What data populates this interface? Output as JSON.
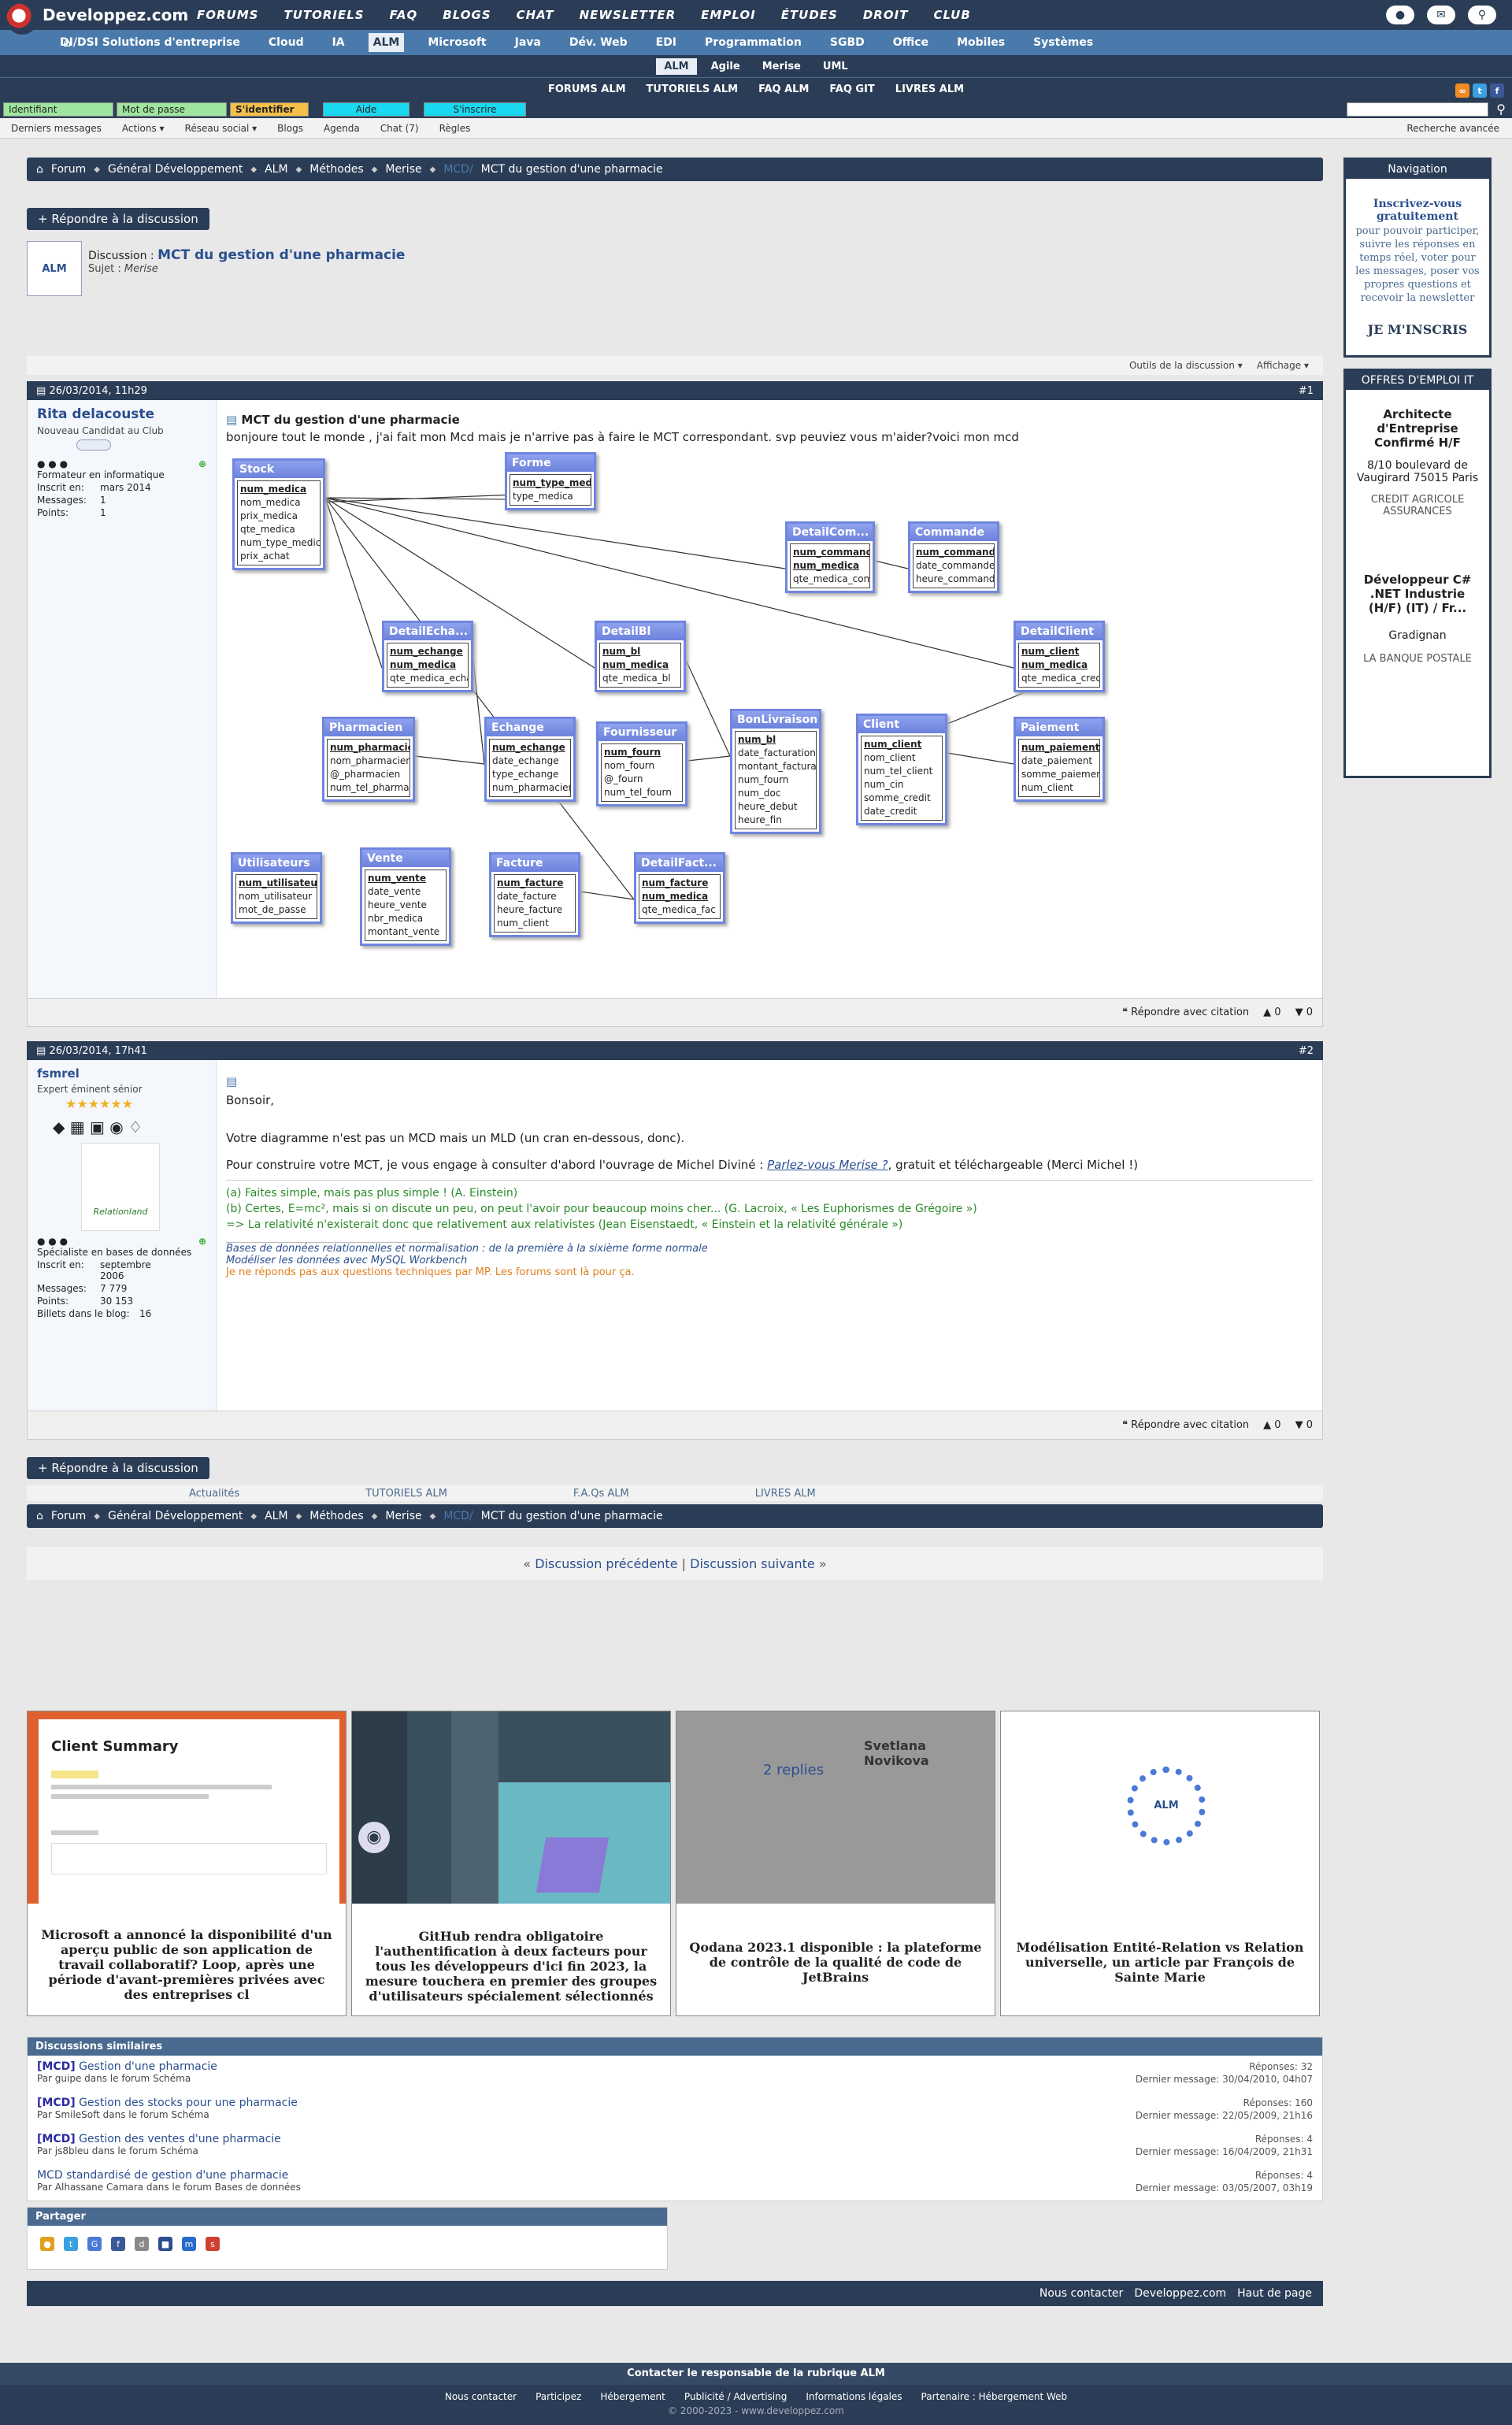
{
  "site": {
    "logo": "Developpez.com"
  },
  "topnav": [
    "FORUMS",
    "TUTORIELS",
    "FAQ",
    "BLOGS",
    "CHAT",
    "NEWSLETTER",
    "EMPLOI",
    "ÉTUDES",
    "DROIT",
    "CLUB"
  ],
  "catnav": [
    "DI/DSI Solutions d'entreprise",
    "Cloud",
    "IA",
    "ALM",
    "Microsoft",
    "Java",
    "Dév. Web",
    "EDI",
    "Programmation",
    "SGBD",
    "Office",
    "Mobiles",
    "Systèmes"
  ],
  "catnav_active": "ALM",
  "subnav": [
    "ALM",
    "Agile",
    "Merise",
    "UML"
  ],
  "subnav_active": "ALM",
  "almnav": [
    "FORUMS ALM",
    "TUTORIELS ALM",
    "FAQ ALM",
    "FAQ GIT",
    "LIVRES ALM"
  ],
  "login": {
    "id": "Identifiant",
    "pwd": "Mot de passe",
    "login": "S'identifier",
    "help": "Aide",
    "register": "S'inscrire"
  },
  "subbar": {
    "items": [
      "Derniers messages",
      "Actions ▾",
      "Réseau social ▾",
      "Blogs",
      "Agenda",
      "Chat (7)",
      "Règles"
    ],
    "right": "Recherche avancée"
  },
  "breadcrumb": [
    "Forum",
    "Général Développement",
    "ALM",
    "Méthodes",
    "Merise",
    "MCT du gestion d'une pharmacie"
  ],
  "breadcrumb_hl": "MCD/",
  "reply_label": "+ Répondre à la discussion",
  "thread": {
    "label": "Discussion :",
    "title": "MCT du gestion d'une pharmacie",
    "subject_label": "Sujet :",
    "subject": "Merise"
  },
  "tools": {
    "a": "Outils de la discussion ▾",
    "b": "Affichage ▾"
  },
  "posts": [
    {
      "date": "26/03/2014, 11h29",
      "num": "#1",
      "user": "Rita delacouste",
      "rank": "Nouveau Candidat au Club",
      "job": "Formateur en informatique",
      "joined_label": "Inscrit en:",
      "joined": "mars 2014",
      "msgs_label": "Messages:",
      "msgs": "1",
      "pts_label": "Points:",
      "pts": "1",
      "title": "MCT du gestion d'une pharmacie",
      "text": "bonjoure tout le monde , j'ai fait mon Mcd mais je n'arrive pas à faire le MCT correspondant. svp peuviez vous m'aider?voici mon mcd"
    },
    {
      "date": "26/03/2014, 17h41",
      "num": "#2",
      "user": "fsmrel",
      "rank": "Expert éminent sénior",
      "job": "Spécialiste en bases de données",
      "joined_label": "Inscrit en:",
      "joined": "septembre 2006",
      "msgs_label": "Messages:",
      "msgs": "7 779",
      "pts_label": "Points:",
      "pts": "30 153",
      "blog_label": "Billets dans le blog:",
      "blog": "16",
      "avatar_caption": "Relationland",
      "greet": "Bonsoir,",
      "p1": "Votre diagramme n'est pas un MCD mais un MLD (un cran en-dessous, donc).",
      "p2a": "Pour construire votre MCT, je vous engage à consulter d'abord l'ouvrage de Michel Diviné :",
      "p2link": "Parlez-vous Merise ?",
      "p2b": ", gratuit et téléchargeable (Merci Michel !)",
      "sig1": "(a) Faites simple, mais pas plus simple ! (A. Einstein)",
      "sig2": "(b) Certes, E=mc², mais si on discute un peu, on peut l'avoir pour beaucoup moins cher... (G. Lacroix, « Les Euphorismes de Grégoire »)",
      "sig3": "=> La relativité n'existerait donc que relativement aux relativistes (Jean Eisenstaedt, « Einstein et la relativité générale »)",
      "ref1": "Bases de données relationnelles et normalisation : de la première à la sixième forme normale",
      "ref2": "Modéliser les données avec MySQL Workbench",
      "ref3": "Je ne réponds pas aux questions techniques par MP. Les forums sont là pour ça."
    }
  ],
  "postfoot": {
    "quote": "Répondre avec citation",
    "up": "0",
    "down": "0"
  },
  "diagram": [
    {
      "name": "Stock",
      "cols": [
        "num_medica",
        "nom_medica",
        "prix_medica",
        "qte_medica",
        "num_type_medic",
        "prix_achat"
      ],
      "keys": 1
    },
    {
      "name": "Forme",
      "cols": [
        "num_type_medic",
        "type_medica"
      ],
      "keys": 1
    },
    {
      "name": "DetailCom...",
      "cols": [
        "num_commande",
        "num_medica",
        "qte_medica_com"
      ],
      "keys": 2
    },
    {
      "name": "Commande",
      "cols": [
        "num_commande",
        "date_commande",
        "heure_commande"
      ],
      "keys": 1
    },
    {
      "name": "DetailEcha...",
      "cols": [
        "num_echange",
        "num_medica",
        "qte_medica_echa"
      ],
      "keys": 2
    },
    {
      "name": "DetailBl",
      "cols": [
        "num_bl",
        "num_medica",
        "qte_medica_bl"
      ],
      "keys": 2
    },
    {
      "name": "DetailClient",
      "cols": [
        "num_client",
        "num_medica",
        "qte_medica_cred"
      ],
      "keys": 2
    },
    {
      "name": "Pharmacien",
      "cols": [
        "num_pharmacien",
        "nom_pharmacien",
        "@_pharmacien",
        "num_tel_pharma"
      ],
      "keys": 1
    },
    {
      "name": "Echange",
      "cols": [
        "num_echange",
        "date_echange",
        "type_echange",
        "num_pharmacien"
      ],
      "keys": 1
    },
    {
      "name": "Fournisseur",
      "cols": [
        "num_fourn",
        "nom_fourn",
        "@_fourn",
        "num_tel_fourn"
      ],
      "keys": 1
    },
    {
      "name": "BonLivraison",
      "cols": [
        "num_bl",
        "date_facturation",
        "montant_factura",
        "num_fourn",
        "num_doc",
        "heure_debut",
        "heure_fin"
      ],
      "keys": 1
    },
    {
      "name": "Client",
      "cols": [
        "num_client",
        "nom_client",
        "num_tel_client",
        "num_cin",
        "somme_credit",
        "date_credit"
      ],
      "keys": 1
    },
    {
      "name": "Paiement",
      "cols": [
        "num_paiement",
        "date_paiement",
        "somme_paiement",
        "num_client"
      ],
      "keys": 1
    },
    {
      "name": "Utilisateurs",
      "cols": [
        "num_utilisateur",
        "nom_utilisateur",
        "mot_de_passe"
      ],
      "keys": 1
    },
    {
      "name": "Vente",
      "cols": [
        "num_vente",
        "date_vente",
        "heure_vente",
        "nbr_medica",
        "montant_vente"
      ],
      "keys": 1
    },
    {
      "name": "Facture",
      "cols": [
        "num_facture",
        "date_facture",
        "heure_facture",
        "num_client"
      ],
      "keys": 1
    },
    {
      "name": "DetailFact...",
      "cols": [
        "num_facture",
        "num_medica",
        "qte_medica_fac"
      ],
      "keys": 2
    }
  ],
  "tabs": [
    "Actualités",
    "TUTORIELS ALM",
    "F.A.Qs ALM",
    "LIVRES ALM"
  ],
  "prevnext": {
    "prev": "Discussion précédente",
    "sep": "|",
    "next": "Discussion suivante"
  },
  "sidebar": {
    "nav_title": "Navigation",
    "nav_head": "Inscrivez-vous gratuitement",
    "nav_text": "pour pouvoir participer, suivre les réponses en temps réel, voter pour les messages, poser vos propres questions et recevoir la newsletter",
    "nav_btn": "JE M'INSCRIS",
    "jobs_title": "OFFRES D'EMPLOI IT",
    "job1": "Architecte d'Entreprise Confirmé H/F",
    "job1_addr": "8/10 boulevard de Vaugirard 75015 Paris",
    "job1_co": "CREDIT AGRICOLE ASSURANCES",
    "job2": "Développeur C# .NET Industrie (H/F) (IT) / Fr...",
    "job2_loc": "Gradignan",
    "job2_co": "LA BANQUE POSTALE"
  },
  "cards": [
    {
      "cap": "Microsoft a annoncé la disponibilité d'un aperçu public de son application de travail collaboratif? Loop, après une période d'avant-premières privées avec des entreprises cl",
      "img": "Client Summary"
    },
    {
      "cap": "GitHub rendra obligatoire l'authentification à deux facteurs pour tous les développeurs d'ici fin 2023, la mesure touchera en premier des groupes d'utilisateurs spécialement sélectionnés",
      "img": ""
    },
    {
      "cap": "Qodana 2023.1 disponible : la plateforme de contrôle de la qualité de code de JetBrains",
      "img": "2 replies",
      "img2": "Svetlana Novikova"
    },
    {
      "cap": "Modélisation Entité-Relation vs Relation universelle, un article par François de Sainte Marie",
      "img": "ALM"
    }
  ],
  "similar": {
    "title": "Discussions similaires",
    "rows": [
      {
        "tag": "[MCD]",
        "t": "Gestion d'une pharmacie",
        "by": "Par guipe dans le forum Schéma",
        "rep": "Réponses: 32",
        "last": "Dernier message: 30/04/2010, 04h07"
      },
      {
        "tag": "[MCD]",
        "t": "Gestion des stocks pour une pharmacie",
        "by": "Par SmileSoft dans le forum Schéma",
        "rep": "Réponses: 160",
        "last": "Dernier message: 22/05/2009, 21h16"
      },
      {
        "tag": "[MCD]",
        "t": "Gestion des ventes d'une pharmacie",
        "by": "Par js8bleu dans le forum Schéma",
        "rep": "Réponses: 4",
        "last": "Dernier message: 16/04/2009, 21h31"
      },
      {
        "tag": "",
        "t": "MCD standardisé de gestion d'une pharmacie",
        "by": "Par Alhassane Camara dans le forum Bases de données",
        "rep": "Réponses: 4",
        "last": "Dernier message: 03/05/2007, 03h19"
      }
    ]
  },
  "share": "Partager",
  "footlinks": [
    "Nous contacter",
    "Developpez.com",
    "Haut de page"
  ],
  "bottom": {
    "l1": "Contacter le responsable de la rubrique ALM",
    "links": [
      "Nous contacter",
      "Participez",
      "Hébergement",
      "Publicité / Advertising",
      "Informations légales",
      "Partenaire : Hébergement Web"
    ],
    "copy": "© 2000-2023 - www.developpez.com"
  }
}
